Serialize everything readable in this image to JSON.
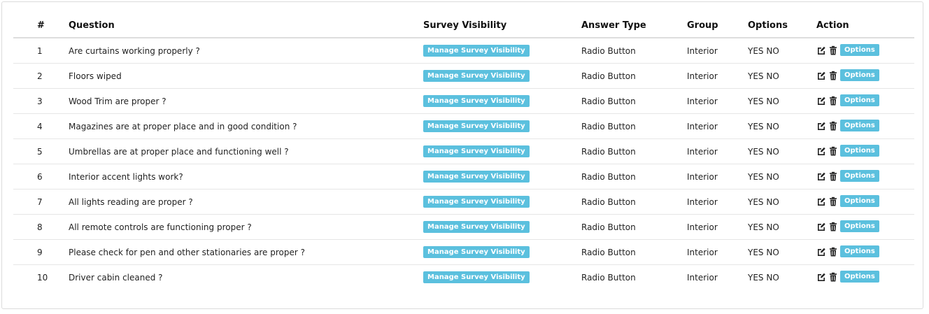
{
  "table": {
    "headers": {
      "num": "#",
      "question": "Question",
      "visibility": "Survey Visibility",
      "answer_type": "Answer Type",
      "group": "Group",
      "options": "Options",
      "action": "Action"
    },
    "rows": [
      {
        "num": "1",
        "question": "Are curtains working properly ?",
        "visibility_btn": "Manage Survey Visibility",
        "answer_type": "Radio Button",
        "group": "Interior",
        "options": "YES NO",
        "options_btn": "Options"
      },
      {
        "num": "2",
        "question": "Floors wiped",
        "visibility_btn": "Manage Survey Visibility",
        "answer_type": "Radio Button",
        "group": "Interior",
        "options": "YES NO",
        "options_btn": "Options"
      },
      {
        "num": "3",
        "question": "Wood Trim are proper ?",
        "visibility_btn": "Manage Survey Visibility",
        "answer_type": "Radio Button",
        "group": "Interior",
        "options": "YES NO",
        "options_btn": "Options"
      },
      {
        "num": "4",
        "question": "Magazines are at proper place and in good condition ?",
        "visibility_btn": "Manage Survey Visibility",
        "answer_type": "Radio Button",
        "group": "Interior",
        "options": "YES NO",
        "options_btn": "Options"
      },
      {
        "num": "5",
        "question": "Umbrellas are at proper place and functioning well ?",
        "visibility_btn": "Manage Survey Visibility",
        "answer_type": "Radio Button",
        "group": "Interior",
        "options": "YES NO",
        "options_btn": "Options"
      },
      {
        "num": "6",
        "question": "Interior accent lights work?",
        "visibility_btn": "Manage Survey Visibility",
        "answer_type": "Radio Button",
        "group": "Interior",
        "options": "YES NO",
        "options_btn": "Options"
      },
      {
        "num": "7",
        "question": "All lights reading are proper ?",
        "visibility_btn": "Manage Survey Visibility",
        "answer_type": "Radio Button",
        "group": "Interior",
        "options": "YES NO",
        "options_btn": "Options"
      },
      {
        "num": "8",
        "question": "All remote controls are functioning proper ?",
        "visibility_btn": "Manage Survey Visibility",
        "answer_type": "Radio Button",
        "group": "Interior",
        "options": "YES NO",
        "options_btn": "Options"
      },
      {
        "num": "9",
        "question": "Please check for pen and other stationaries are proper ?",
        "visibility_btn": "Manage Survey Visibility",
        "answer_type": "Radio Button",
        "group": "Interior",
        "options": "YES NO",
        "options_btn": "Options"
      },
      {
        "num": "10",
        "question": "Driver cabin cleaned ?",
        "visibility_btn": "Manage Survey Visibility",
        "answer_type": "Radio Button",
        "group": "Interior",
        "options": "YES NO",
        "options_btn": "Options"
      }
    ]
  },
  "icons": {
    "edit": "edit-icon",
    "delete": "trash-icon"
  },
  "colors": {
    "info_button": "#5bc0de",
    "border": "#dddddd"
  }
}
